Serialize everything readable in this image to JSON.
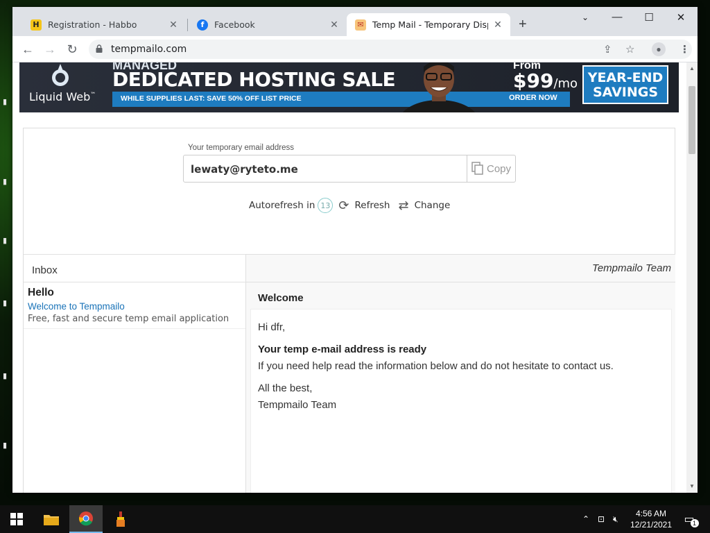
{
  "browser": {
    "tabs": [
      {
        "title": "Registration - Habbo",
        "active": false
      },
      {
        "title": "Facebook",
        "active": false
      },
      {
        "title": "Temp Mail - Temporary Disposa",
        "active": true
      }
    ],
    "url": "tempmailo.com"
  },
  "ad": {
    "brand": "Liquid Web",
    "brand_mark": "™",
    "kicker": "MANAGED",
    "headline": "DEDICATED HOSTING SALE",
    "strip_text": "WHILE SUPPLIES LAST: SAVE 50% OFF LIST PRICE",
    "from_label": "From",
    "price": "$99",
    "price_unit": "/mo",
    "order_label": "ORDER NOW",
    "badge_line1": "YEAR-END",
    "badge_line2": "SAVINGS"
  },
  "mail": {
    "address_label": "Your temporary email address",
    "address": "lewaty@ryteto.me",
    "copy_label": "Copy",
    "autorefresh_label": "Autorefresh in",
    "autorefresh_seconds": "13",
    "refresh_label": "Refresh",
    "change_label": "Change"
  },
  "inbox": {
    "title": "Inbox",
    "sender_header": "Tempmailo Team",
    "items": [
      {
        "from": "Hello",
        "subject": "Welcome to Tempmailo",
        "preview": "Free, fast and secure temp email application"
      }
    ]
  },
  "message": {
    "subject": "Welcome",
    "greeting": "Hi dfr,",
    "heading": "Your temp e-mail address is ready",
    "body": "If you need help read the information below and do not hesitate to contact us.",
    "closing": "All the best,",
    "signature": "Tempmailo Team"
  },
  "taskbar": {
    "time": "4:56 AM",
    "date": "12/21/2021",
    "notification_count": "1"
  },
  "colors": {
    "link": "#1a73b8",
    "ad_blue": "#1e7cc0",
    "taskbar": "#101010"
  }
}
